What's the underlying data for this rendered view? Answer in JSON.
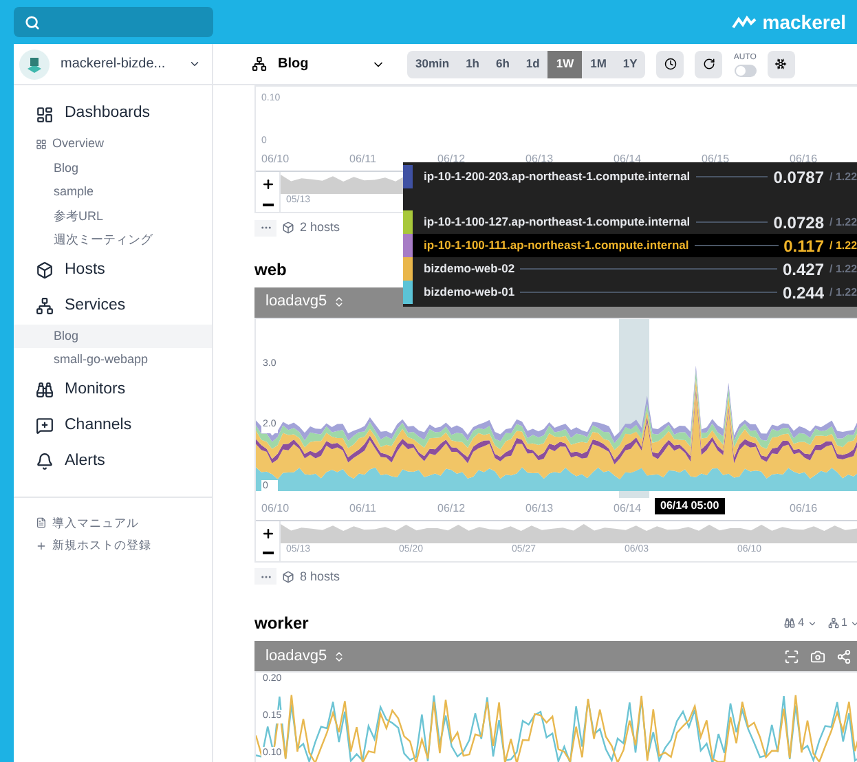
{
  "logo": {
    "text": "mackerel"
  },
  "org": {
    "name": "mackerel-bizde..."
  },
  "sidebar": {
    "sections": [
      {
        "label": "Dashboards",
        "selected": false,
        "children": [
          {
            "label": "Overview",
            "selected": false
          },
          {
            "label": "Blog",
            "selected": false
          },
          {
            "label": "sample",
            "selected": false
          },
          {
            "label": "参考URL",
            "selected": false
          },
          {
            "label": "週次ミーティング",
            "selected": false
          }
        ]
      },
      {
        "label": "Hosts",
        "selected": false
      },
      {
        "label": "Services",
        "selected": false,
        "children": [
          {
            "label": "Blog",
            "selected": true
          },
          {
            "label": "small-go-webapp",
            "selected": false
          }
        ]
      },
      {
        "label": "Monitors",
        "selected": false
      },
      {
        "label": "Channels",
        "selected": false
      },
      {
        "label": "Alerts",
        "selected": false
      }
    ],
    "footer_links": [
      {
        "label": "導入マニュアル"
      },
      {
        "label": "新規ホストの登録"
      }
    ]
  },
  "toolbar": {
    "service": "Blog",
    "ranges": [
      {
        "label": "30min",
        "selected": false
      },
      {
        "label": "1h",
        "selected": false
      },
      {
        "label": "6h",
        "selected": false
      },
      {
        "label": "1d",
        "selected": false
      },
      {
        "label": "1W",
        "selected": true
      },
      {
        "label": "1M",
        "selected": false
      },
      {
        "label": "1Y",
        "selected": false
      }
    ],
    "auto": {
      "label": "AUTO",
      "on": false
    }
  },
  "top_graph": {
    "y_ticks": [
      "0.10",
      "0"
    ],
    "x_ticks": [
      "06/10",
      "06/11",
      "06/12",
      "06/13",
      "06/14",
      "06/15",
      "06/16"
    ],
    "navigator_ticks": [
      "05/13"
    ],
    "hosts": "2 hosts"
  },
  "tooltip": {
    "rows": [
      {
        "name": "ip-10-1-200-203.ap-northeast-1.compute.internal",
        "value": "0.0787",
        "total": "/ 1.22",
        "color": "#3f51a3",
        "selected": false
      },
      {
        "name": "ip-10-1-100-127.ap-northeast-1.compute.internal",
        "value": "0.0728",
        "total": "/ 1.22",
        "color": "#a8c83a",
        "selected": false
      },
      {
        "name": "ip-10-1-100-111.ap-northeast-1.compute.internal",
        "value": "0.117",
        "total": "/ 1.22",
        "color": "#a77cc6",
        "selected": true
      },
      {
        "name": "bizdemo-web-02",
        "value": "0.427",
        "total": "/ 1.22",
        "color": "#e9b64a",
        "selected": false
      },
      {
        "name": "bizdemo-web-01",
        "value": "0.244",
        "total": "/ 1.22",
        "color": "#5bc3d6",
        "selected": false
      }
    ]
  },
  "web": {
    "title": "web",
    "metric": "loadavg5",
    "y_ticks": [
      "3.0",
      "2.0",
      "0"
    ],
    "x_ticks": [
      "06/10",
      "06/11",
      "06/12",
      "06/13",
      "06/14",
      "06/16"
    ],
    "cursor_label": "06/14 05:00",
    "navigator_ticks": [
      "05/13",
      "05/20",
      "05/27",
      "06/03",
      "06/10"
    ],
    "hosts": "8 hosts"
  },
  "worker": {
    "title": "worker",
    "monitors": "4",
    "roles": "1",
    "metric": "loadavg5",
    "y_ticks": [
      "0.20",
      "0.15",
      "0.10"
    ]
  }
}
